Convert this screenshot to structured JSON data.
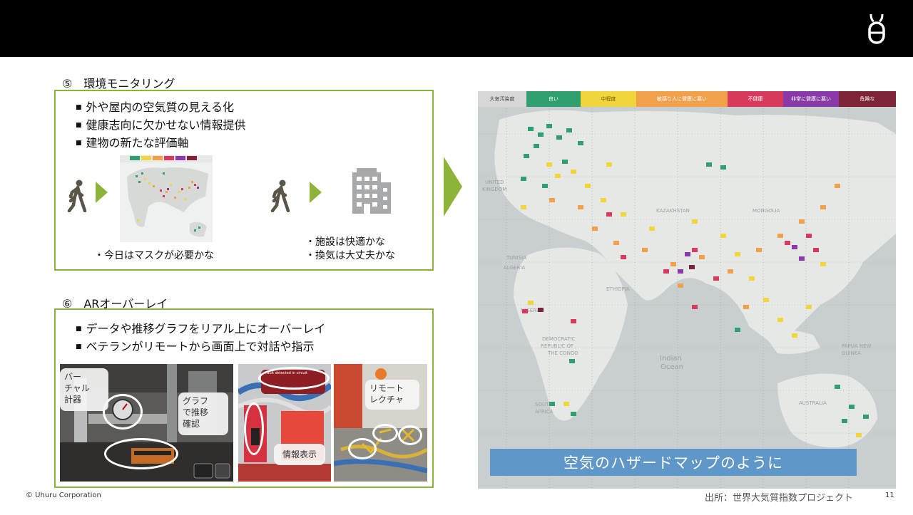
{
  "header": {
    "logo": "uhuru-logo-icon"
  },
  "section5": {
    "title": "⑤　環境モニタリング",
    "bullets": [
      "外や屋内の空気質の見える化",
      "健康志向に欠かせない情報提供",
      "建物の新たな評価軸"
    ],
    "caption_left": "・今日はマスクが必要かな",
    "caption_right": [
      "・施設は快適かな",
      "・換気は大丈夫かな"
    ]
  },
  "section6": {
    "title": "⑥　ARオーバーレイ",
    "bullets": [
      "データや推移グラフをリアル上にオーバーレイ",
      "ベテランがリモートから画面上で対話や指示"
    ],
    "photo1_callouts": {
      "virtual_meter": "バー\nチャル\n計器",
      "graph": "グラフ\nで推移\n確認"
    },
    "photo2_callout": "情報表示",
    "photo2_alert": "Fault detected in circuit",
    "photo3_callout": "リモート\nレクチャ"
  },
  "aqi_map": {
    "legend": [
      {
        "label": "大気汚染度",
        "color": "#cfcfcf"
      },
      {
        "label": "良い",
        "color": "#2e9f6d"
      },
      {
        "label": "中程度",
        "color": "#f0d53c"
      },
      {
        "label": "敏感な人に健康に悪い",
        "color": "#f2a04a"
      },
      {
        "label": "不健康",
        "color": "#d83a5e"
      },
      {
        "label": "非常に健康に悪い",
        "color": "#8a3aa8"
      },
      {
        "label": "危険な",
        "color": "#7d2436"
      }
    ],
    "banner": "空気のハザードマップのように"
  },
  "footer": {
    "copyright": "© Uhuru Corporation",
    "source": "出所：世界大気質指数プロジェクト",
    "page": "11"
  }
}
